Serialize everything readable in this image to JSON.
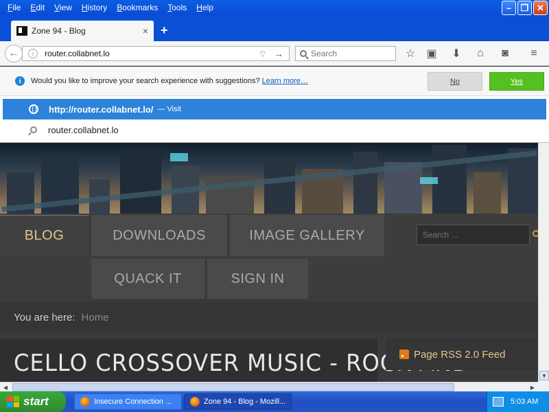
{
  "menu": {
    "items": [
      {
        "label": "File",
        "key": "F",
        "rest": "ile"
      },
      {
        "label": "Edit",
        "key": "E",
        "rest": "dit"
      },
      {
        "label": "View",
        "key": "V",
        "rest": "iew"
      },
      {
        "label": "History",
        "key": "H",
        "rest": "istory"
      },
      {
        "label": "Bookmarks",
        "key": "B",
        "rest": "ookmarks"
      },
      {
        "label": "Tools",
        "key": "T",
        "rest": "ools"
      },
      {
        "label": "Help",
        "key": "H",
        "rest": "elp"
      }
    ]
  },
  "window_controls": {
    "minimize": "–",
    "maximize": "❐",
    "close": "✕"
  },
  "tab": {
    "title": "Zone 94 - Blog",
    "close": "×",
    "new_tab": "+"
  },
  "navbar": {
    "url": "router.collabnet.lo",
    "search_placeholder": "Search",
    "back": "←",
    "go": "→",
    "dropdown": "▽"
  },
  "suggestions": {
    "prompt": "Would you like to improve your search experience with suggestions?",
    "learn_more": "Learn more…",
    "no": "No",
    "yes": "Yes"
  },
  "results": {
    "selected_url": "http://router.collabnet.lo/",
    "selected_action": "— Visit",
    "plain": "router.collabnet.lo"
  },
  "site": {
    "nav": {
      "blog": "BLOG",
      "downloads": "DOWNLOADS",
      "image_gallery": "IMAGE GALLERY",
      "quack_it": "QUACK IT",
      "sign_in": "SIGN IN"
    },
    "search_placeholder": "Search ...",
    "breadcrumb_label": "You are here:",
    "breadcrumb_home": "Home",
    "article_title": "CELLO CROSSOVER MUSIC - ROCK AND",
    "rss_label": "Page RSS 2.0 Feed"
  },
  "taskbar": {
    "start": "start",
    "tasks": [
      "Insecure Connection ...",
      "Zone 94 - Blog - Mozill..."
    ],
    "clock": "5:03 AM"
  },
  "icons": {
    "bookmark_star": "☆",
    "reading_list": "▣",
    "download": "⬇",
    "home": "⌂",
    "pocket": "◙",
    "menu": "≡"
  },
  "colors": {
    "xp_blue": "#0b4fd6",
    "accent_gold": "#e2c787",
    "result_highlight": "#2d83d9",
    "yes_green": "#55c020"
  }
}
